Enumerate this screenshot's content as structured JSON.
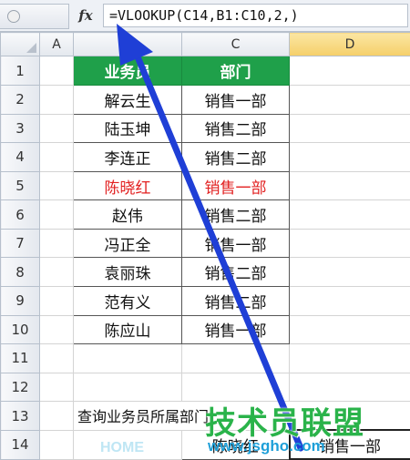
{
  "formula_bar": {
    "fx_label": "fx",
    "formula": "=VLOOKUP(C14,B1:C10,2,)"
  },
  "columns": [
    "A",
    "B",
    "C",
    "D"
  ],
  "selected_column": "D",
  "rows": [
    "1",
    "2",
    "3",
    "4",
    "5",
    "6",
    "7",
    "8",
    "9",
    "10",
    "11",
    "12",
    "13",
    "14"
  ],
  "table": {
    "header": [
      "业务员",
      "部门"
    ],
    "data": [
      [
        "解云生",
        "销售一部"
      ],
      [
        "陆玉坤",
        "销售二部"
      ],
      [
        "李连正",
        "销售二部"
      ],
      [
        "陈晓红",
        "销售一部"
      ],
      [
        "赵伟",
        "销售二部"
      ],
      [
        "冯正全",
        "销售一部"
      ],
      [
        "袁丽珠",
        "销售二部"
      ],
      [
        "范有义",
        "销售二部"
      ],
      [
        "陈应山",
        "销售一部"
      ]
    ],
    "highlight_row": 3,
    "highlight_color": "#e22020",
    "header_bg": "#1fa04a"
  },
  "query_label": "查询业务员所属部门",
  "row14": {
    "c": "陈晓红",
    "d": "销售一部"
  },
  "watermark": {
    "brand": "技术员联盟",
    "url": "www.jsgho.com",
    "faint": "HOME"
  },
  "arrow_color": "#1f3fd6"
}
